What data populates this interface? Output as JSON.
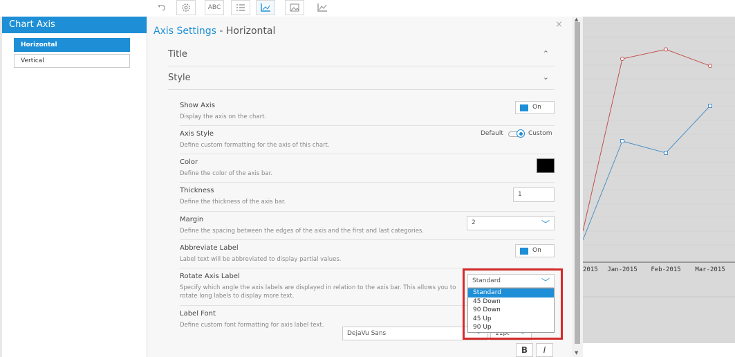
{
  "toolbar": {
    "icons": [
      "undo-icon",
      "settings-gear-icon",
      "abc-label-icon",
      "list-icon",
      "axis-icon",
      "image-icon",
      "line-chart-icon"
    ],
    "abc_label": "ABC"
  },
  "sidebar": {
    "title": "Chart Axis",
    "items": [
      {
        "label": "Horizontal",
        "active": true
      },
      {
        "label": "Vertical",
        "active": false
      }
    ]
  },
  "panel": {
    "title_accent": "Axis Settings",
    "title_rest": " - Horizontal",
    "sections": [
      {
        "label": "Title",
        "expanded": false
      },
      {
        "label": "Style",
        "expanded": true
      }
    ],
    "rows": [
      {
        "label": "Show Axis",
        "desc": "Display the axis on the chart.",
        "value": "On"
      },
      {
        "label": "Axis Style",
        "desc": "Define custom formatting for the axis of this chart.",
        "option_default": "Default",
        "option_custom": "Custom"
      },
      {
        "label": "Color",
        "desc": "Define the color of the axis bar.",
        "color": "#000000"
      },
      {
        "label": "Thickness",
        "desc": "Define the thickness of the axis bar.",
        "value": "1"
      },
      {
        "label": "Margin",
        "desc": "Define the spacing between the edges of the axis and the first and last categories.",
        "value": "2"
      },
      {
        "label": "Abbreviate Label",
        "desc": "Label text will be abbreviated to display partial values.",
        "value": "On"
      },
      {
        "label": "Rotate Axis Label",
        "desc": "Specify which angle the axis labels are displayed in relation to the axis bar. This allows you to rotate long labels to display more text.",
        "value": "Standard"
      },
      {
        "label": "Label Font",
        "desc": "Define custom font formatting for axis label text.",
        "font": "DejaVu Sans",
        "size": "11pt"
      }
    ],
    "rotate_options": [
      "Standard",
      "45 Down",
      "90 Down",
      "45 Up",
      "90 Up"
    ],
    "bold_label": "B",
    "italic_label": "I"
  },
  "chart_data": {
    "type": "line",
    "categories": [
      "2015",
      "Jan-2015",
      "Feb-2015",
      "Mar-2015"
    ],
    "series": [
      {
        "color": "#c0504d",
        "values": [
          null,
          0.85,
          0.89,
          0.82
        ]
      },
      {
        "color": "#4a90c8",
        "values": [
          0.08,
          0.5,
          0.45,
          0.65
        ]
      }
    ]
  }
}
